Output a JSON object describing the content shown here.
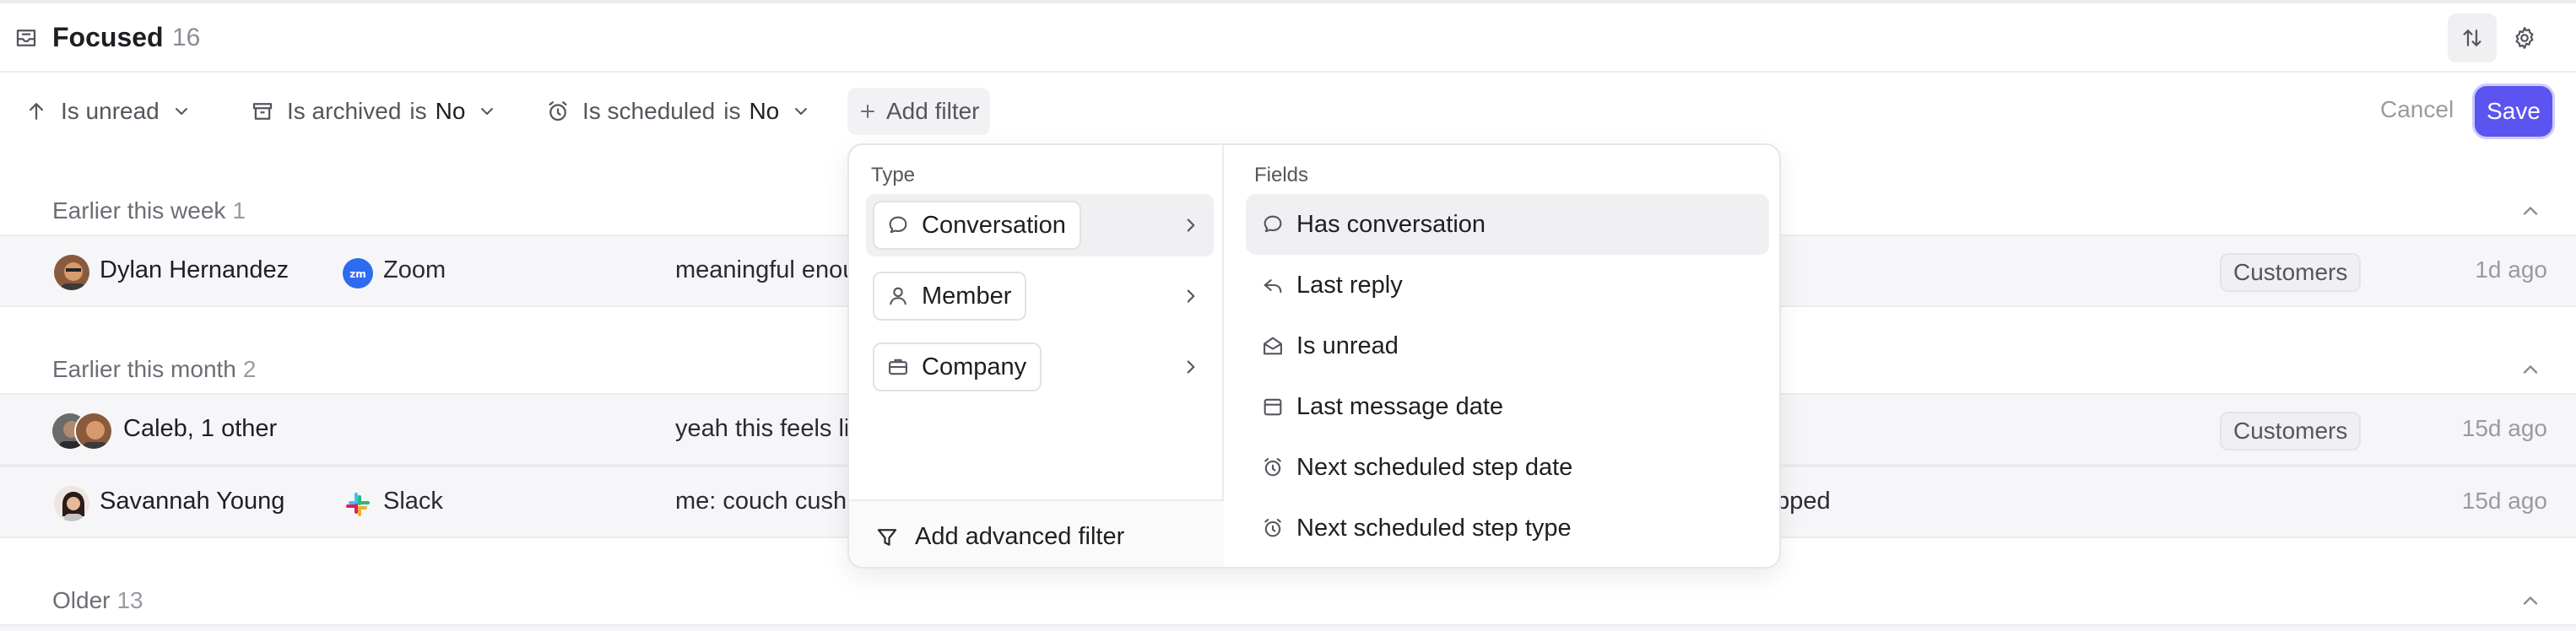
{
  "header": {
    "title": "Focused",
    "count": "16"
  },
  "filters": {
    "sort_label": "Is unread",
    "archived": {
      "label": "Is archived",
      "op": "is",
      "value": "No"
    },
    "scheduled": {
      "label": "Is scheduled",
      "op": "is",
      "value": "No"
    },
    "add_filter": "Add filter",
    "cancel": "Cancel",
    "save": "Save"
  },
  "groups": [
    {
      "title": "Earlier this week",
      "count": "1"
    },
    {
      "title": "Earlier this month",
      "count": "2"
    },
    {
      "title": "Older",
      "count": "13"
    }
  ],
  "rows": [
    {
      "name": "Dylan Hernandez",
      "source": "Zoom",
      "preview": "meaningful enou",
      "preview_right": "",
      "tag": "Customers",
      "time": "1d ago"
    },
    {
      "name": "Caleb, 1 other",
      "source": "",
      "preview": "yeah this feels li",
      "preview_right": "",
      "tag": "Customers",
      "time": "15d ago"
    },
    {
      "name": "Savannah Young",
      "source": "Slack",
      "preview": "me: couch cush",
      "preview_right": "opped",
      "tag": "",
      "time": "15d ago"
    }
  ],
  "dropdown": {
    "type_label": "Type",
    "fields_label": "Fields",
    "types": [
      {
        "label": "Conversation",
        "icon": "chat-bubble-icon"
      },
      {
        "label": "Member",
        "icon": "person-icon"
      },
      {
        "label": "Company",
        "icon": "briefcase-icon"
      }
    ],
    "fields": [
      {
        "label": "Has conversation",
        "icon": "chat-bubble-icon"
      },
      {
        "label": "Last reply",
        "icon": "reply-icon"
      },
      {
        "label": "Is unread",
        "icon": "envelope-open-icon"
      },
      {
        "label": "Last message date",
        "icon": "calendar-icon"
      },
      {
        "label": "Next scheduled step date",
        "icon": "alarm-clock-icon"
      },
      {
        "label": "Next scheduled step type",
        "icon": "alarm-clock-icon"
      }
    ],
    "advanced": "Add advanced filter"
  },
  "colors": {
    "accent": "#5b54f0",
    "zoom": "#2d6bf0",
    "row_bg": "#f6f6f8"
  }
}
